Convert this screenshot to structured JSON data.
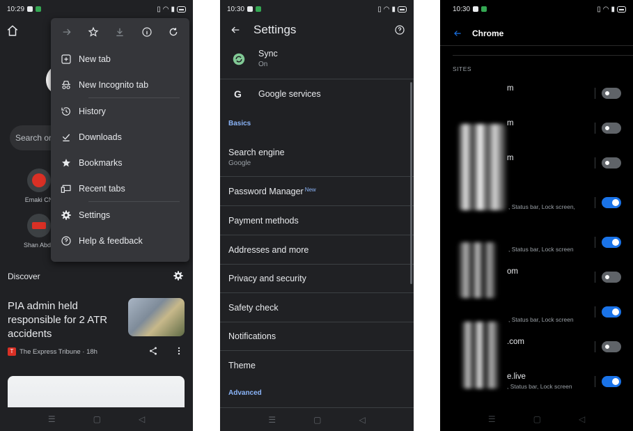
{
  "screen1": {
    "status": {
      "time": "10:29"
    },
    "search_placeholder": "Search or",
    "shortcuts": [
      {
        "label": "Emaki CN"
      },
      {
        "label": "Shan Abdu"
      }
    ],
    "menu": {
      "top_icons": [
        "forward-icon",
        "bookmark-star-icon",
        "download-icon",
        "info-icon",
        "refresh-icon"
      ],
      "items": [
        {
          "label": "New tab",
          "icon": "plus-box-icon"
        },
        {
          "label": "New Incognito tab",
          "icon": "incognito-icon"
        },
        {
          "label": "History",
          "icon": "history-icon"
        },
        {
          "label": "Downloads",
          "icon": "download-check-icon"
        },
        {
          "label": "Bookmarks",
          "icon": "star-icon"
        },
        {
          "label": "Recent tabs",
          "icon": "devices-icon"
        },
        {
          "label": "Settings",
          "icon": "gear-icon"
        },
        {
          "label": "Help & feedback",
          "icon": "help-icon"
        }
      ]
    },
    "discover_label": "Discover",
    "article": {
      "title": "PIA admin held responsible for 2 ATR accidents",
      "source": "The Express Tribune · 18h"
    }
  },
  "screen2": {
    "status": {
      "time": "10:30"
    },
    "title": "Settings",
    "sync": {
      "label": "Sync",
      "value": "On"
    },
    "google_services": "Google services",
    "basics_header": "Basics",
    "search_engine": {
      "label": "Search engine",
      "value": "Google"
    },
    "password_manager": {
      "label": "Password Manager",
      "badge": "New"
    },
    "rows": [
      "Payment methods",
      "Addresses and more",
      "Privacy and security",
      "Safety check",
      "Notifications",
      "Theme"
    ],
    "advanced_header": "Advanced"
  },
  "screen3": {
    "status": {
      "time": "10:30"
    },
    "title": "Chrome",
    "sites_header": "SITES",
    "sites": [
      {
        "name": "m",
        "detail": "",
        "enabled": false
      },
      {
        "name": "m",
        "detail": "",
        "enabled": false
      },
      {
        "name": "m",
        "detail": "",
        "enabled": false
      },
      {
        "name": "",
        "detail": ", Status bar, Lock screen,",
        "enabled": true
      },
      {
        "name": "",
        "detail": ", Status bar, Lock screen",
        "enabled": true
      },
      {
        "name": "om",
        "detail": "",
        "enabled": false
      },
      {
        "name": "",
        "detail": ", Status bar, Lock screen",
        "enabled": true
      },
      {
        "name": ".com",
        "detail": "",
        "enabled": false
      },
      {
        "name": "e.live",
        "detail": ", Status bar, Lock screen",
        "enabled": true
      }
    ]
  },
  "colors": {
    "dark_bg": "#202124",
    "menu_bg": "#35363a",
    "accent": "#8ab4f8",
    "toggle_on": "#1a73e8"
  }
}
